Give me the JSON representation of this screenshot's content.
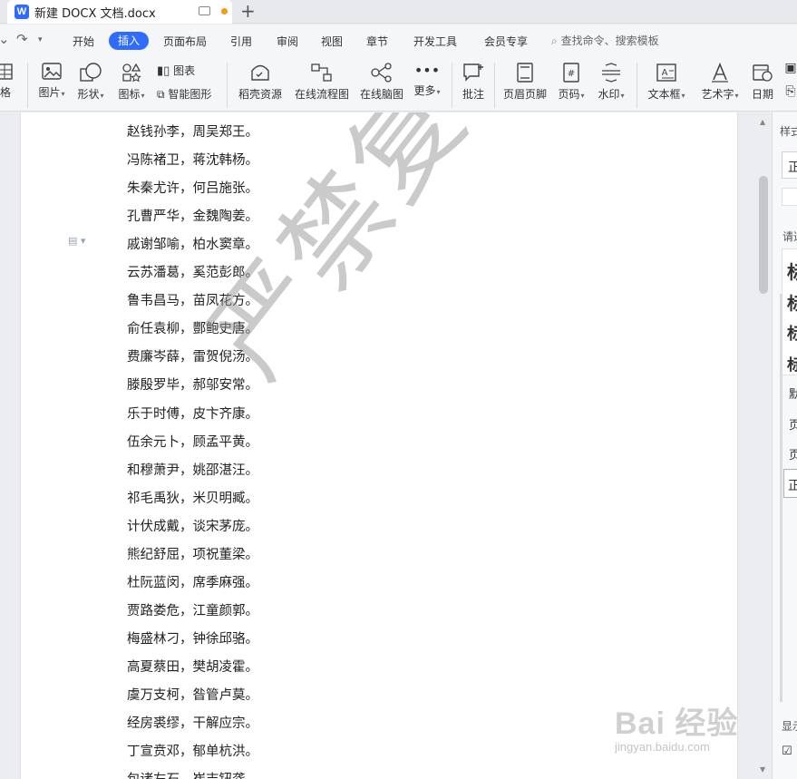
{
  "window": {
    "doc_title": "新建 DOCX 文档.docx",
    "app_logo": "W"
  },
  "menu": {
    "items": [
      "开始",
      "插入",
      "页面布局",
      "引用",
      "审阅",
      "视图",
      "章节",
      "开发工具",
      "会员专享"
    ],
    "active": "插入",
    "search_placeholder": "查找命令、搜索模板"
  },
  "ribbon": {
    "left_partial": "格",
    "picture": "图片",
    "shape": "形状",
    "icon": "图标",
    "chart": "图表",
    "smart_shape": "智能图形",
    "resources": "稻壳资源",
    "flowchart": "在线流程图",
    "mindmap": "在线脑图",
    "more": "更多",
    "comment": "批注",
    "header_footer": "页眉页脚",
    "page_number": "页码",
    "watermark": "水印",
    "textbox": "文本框",
    "wordart": "艺术字",
    "date": "日期"
  },
  "document": {
    "lines": [
      "赵钱孙李，周吴郑王。",
      "冯陈褚卫，蒋沈韩杨。",
      "朱秦尤许，何吕施张。",
      "孔曹严华，金魏陶姜。",
      "戚谢邹喻，柏水窦章。",
      "云苏潘葛，奚范彭郎。",
      "鲁韦昌马，苗凤花方。",
      "俞任袁柳，酆鲍史唐。",
      "费廉岑薛，雷贺倪汤。",
      "滕殷罗毕，郝邬安常。",
      "乐于时傅，皮卞齐康。",
      "伍余元卜，顾孟平黄。",
      "和穆萧尹，姚邵湛汪。",
      "祁毛禹狄，米贝明臧。",
      "计伏成戴，谈宋茅庞。",
      "熊纪舒屈，项祝董梁。",
      "杜阮蓝闵，席季麻强。",
      "贾路娄危，江童颜郭。",
      "梅盛林刁，钟徐邱骆。",
      "高夏蔡田，樊胡凌霍。",
      "虞万支柯，昝管卢莫。",
      "经房裘缪，干解应宗。",
      "丁宣贲邓，郁单杭洪。",
      "包诸左石，崔吉钮龚。"
    ],
    "watermark": "严禁复制"
  },
  "right_panel": {
    "labels": [
      "样式",
      "正",
      "请选",
      "标",
      "标",
      "标",
      "标",
      "默",
      "页",
      "页",
      "正",
      "显示"
    ]
  },
  "baidu": {
    "logo": "Bai  经验",
    "url": "jingyan.baidu.com"
  }
}
